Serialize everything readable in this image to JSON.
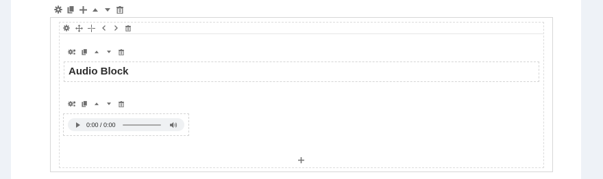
{
  "heading": {
    "text": "Audio Block"
  },
  "audio": {
    "time_display": "0:00 / 0:00",
    "progress": 0
  },
  "colors": {
    "page_bg": "#eef2f7",
    "icon": "#6f6f6f",
    "border": "#d7d7d7"
  },
  "icons": {
    "section_toolbar": [
      "gear-icon",
      "duplicate-icon",
      "plus-icon",
      "arrow-up-icon",
      "arrow-down-icon",
      "trash-icon"
    ],
    "row_toolbar": [
      "gear-icon",
      "move-icon",
      "move-alt-icon",
      "arrow-left-icon",
      "arrow-right-icon",
      "trash-icon"
    ],
    "block_toolbar": [
      "gears-icon",
      "duplicate-icon",
      "arrow-up-icon",
      "arrow-down-icon",
      "trash-icon"
    ],
    "add": "plus-icon"
  }
}
